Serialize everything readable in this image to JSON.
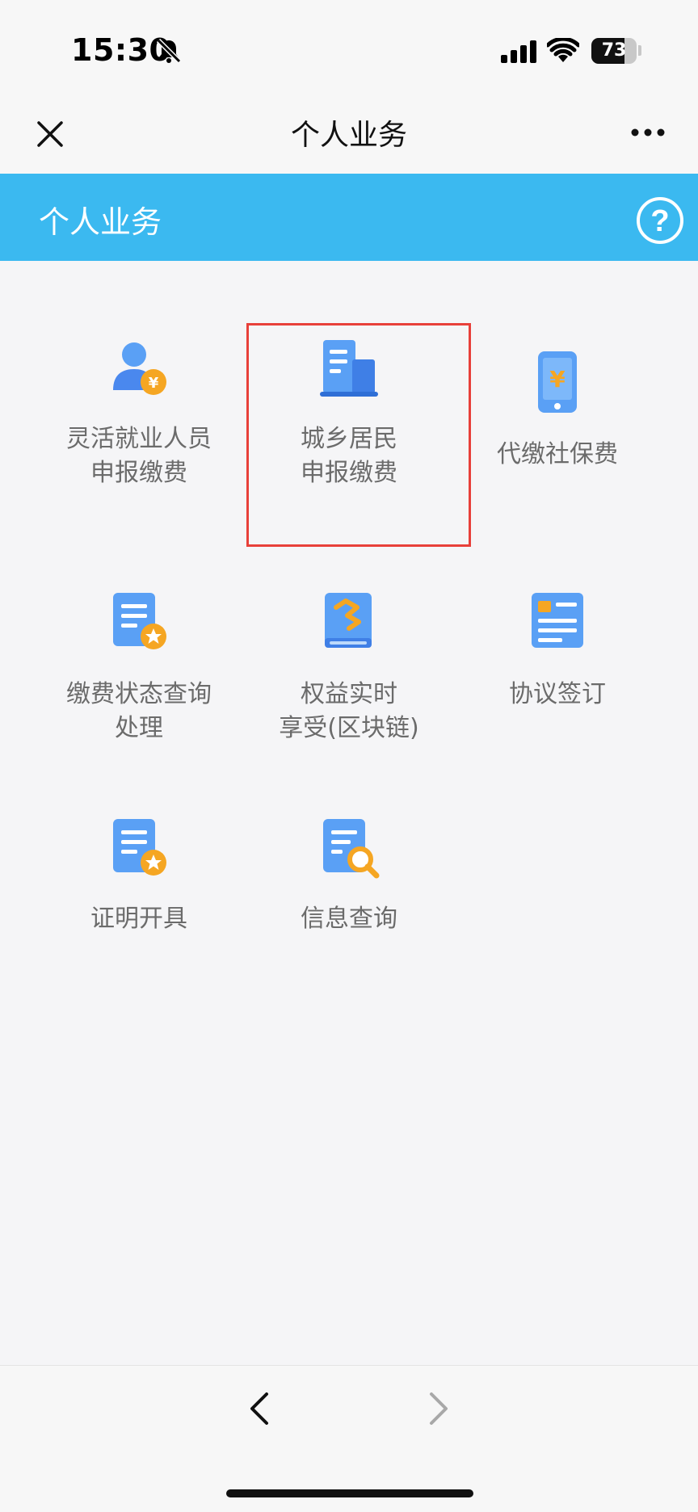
{
  "status_bar": {
    "time": "15:30",
    "battery": "73",
    "battery_level": 0.73
  },
  "nav": {
    "title": "个人业务"
  },
  "header": {
    "title": "个人业务"
  },
  "items": [
    {
      "line1": "灵活就业人员",
      "line2": "申报缴费",
      "icon": "person-yuan-icon"
    },
    {
      "line1": "城乡居民",
      "line2": "申报缴费",
      "icon": "building-icon"
    },
    {
      "line1": "代缴社保费",
      "line2": "",
      "icon": "phone-yuan-icon"
    },
    {
      "line1": "缴费状态查询",
      "line2": "处理",
      "icon": "document-star-icon"
    },
    {
      "line1": "权益实时",
      "line2": "享受(区块链)",
      "icon": "book-icon"
    },
    {
      "line1": "协议签订",
      "line2": "",
      "icon": "contract-icon"
    },
    {
      "line1": "证明开具",
      "line2": "",
      "icon": "certificate-star-icon"
    },
    {
      "line1": "信息查询",
      "line2": "",
      "icon": "document-search-icon"
    }
  ],
  "colors": {
    "accent": "#3bb9f0",
    "icon_blue": "#4a90f0",
    "icon_orange": "#f5a623",
    "highlight": "#e8403a"
  }
}
